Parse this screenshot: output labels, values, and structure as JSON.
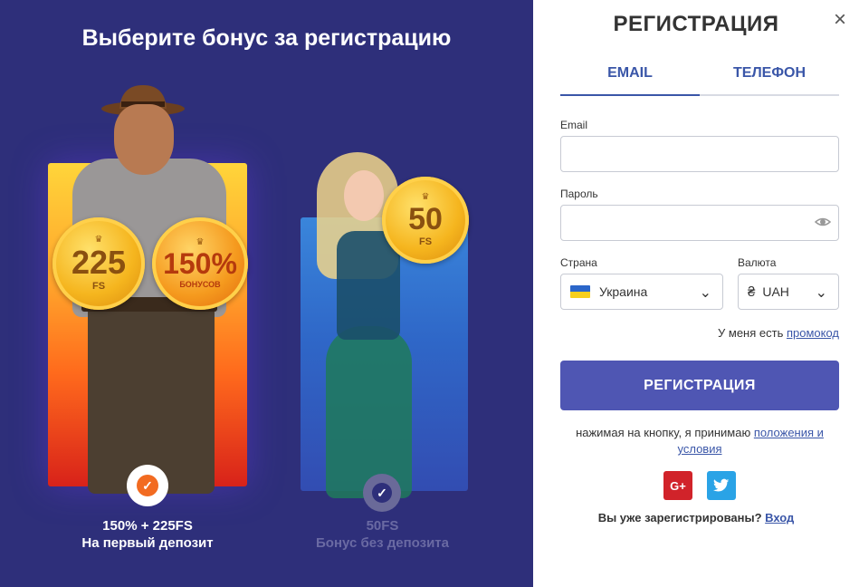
{
  "left": {
    "title": "Выберите бонус за регистрацию",
    "bonus_a": {
      "coin1_value": "225",
      "coin1_sub": "FS",
      "coin2_value": "150%",
      "coin2_sub": "БОНУСОВ",
      "line1": "150% + 225FS",
      "line2": "На первый депозит",
      "selected": true
    },
    "bonus_b": {
      "coin_value": "50",
      "coin_sub": "FS",
      "line1": "50FS",
      "line2": "Бонус без депозита",
      "selected": false
    }
  },
  "right": {
    "title": "РЕГИСТРАЦИЯ",
    "close_icon": "×",
    "tabs": [
      {
        "label": "EMAIL",
        "active": true
      },
      {
        "label": "ТЕЛЕФОН",
        "active": false
      }
    ],
    "email_label": "Email",
    "email_value": "",
    "password_label": "Пароль",
    "password_value": "",
    "country_label": "Страна",
    "country_value": "Украина",
    "currency_label": "Валюта",
    "currency_value": "UAH",
    "promo_text": "У меня есть",
    "promo_link": "промокод",
    "register_button": "РЕГИСТРАЦИЯ",
    "terms_text": "нажимая на кнопку, я принимаю",
    "terms_link": "положения и условия",
    "social": [
      "google-plus",
      "twitter"
    ],
    "login_text": "Вы уже зарегистрированы?",
    "login_link": "Вход"
  },
  "colors": {
    "left_bg": "#2e2f7a",
    "accent": "#4f56b3",
    "link": "#3a56a8",
    "check_orange": "#f26b21"
  }
}
